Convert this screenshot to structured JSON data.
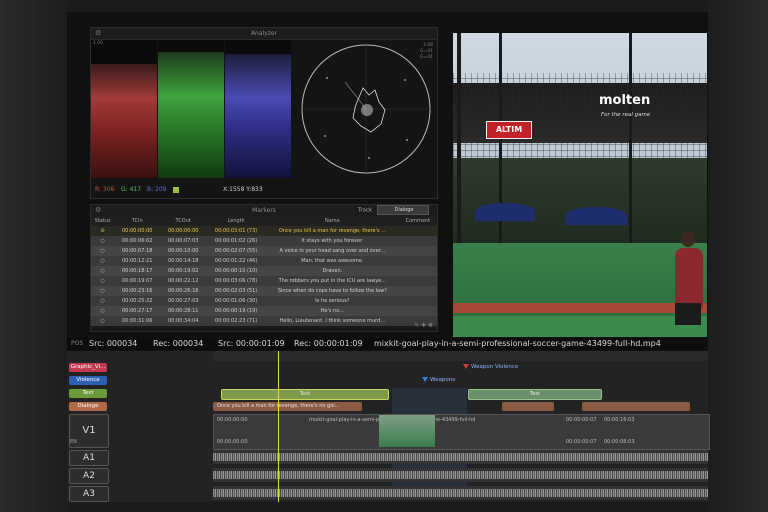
{
  "analyzer": {
    "title": "Analyzer",
    "readout_r": "R: 306",
    "readout_g": "G: 417",
    "readout_b": "B: 209",
    "readout_xy": "X:1558 Y:833",
    "scale_top": "1.00",
    "scale_lines": [
      "1:48",
      "G=41",
      "G=41"
    ]
  },
  "markers": {
    "title": "Markers",
    "track_label": "Track",
    "track_value": "Dialoge",
    "columns": [
      "Status",
      "TCIn",
      "TCOut",
      "Length",
      "Name",
      "Comment"
    ],
    "rows": [
      {
        "tcin": "00:00:00:00",
        "tcout": "00:00:00:00",
        "length": "00:00:03:01 (73)",
        "name": "Once you kill a man for revenge, there's ...",
        "selected": true
      },
      {
        "tcin": "00:00:06:02",
        "tcout": "00:00:07:03",
        "length": "00:00:01:02 (26)",
        "name": "It stays with you forever."
      },
      {
        "tcin": "00:00:07:18",
        "tcout": "00:00:10:00",
        "length": "00:00:02:07 (55)",
        "name": "A voice in your head sang over and over..."
      },
      {
        "tcin": "00:00:12:21",
        "tcout": "00:00:14:18",
        "length": "00:00:01:22 (46)",
        "name": "Man, that was awesome."
      },
      {
        "tcin": "00:00:18:17",
        "tcout": "00:00:19:02",
        "length": "00:00:00:10 (10)",
        "name": "Draven."
      },
      {
        "tcin": "00:00:19:07",
        "tcout": "00:00:22:12",
        "length": "00:00:03:06 (78)",
        "name": "The robbers you put in the ICU are lawye..."
      },
      {
        "tcin": "00:00:23:16",
        "tcout": "00:00:26:16",
        "length": "00:00:02:03 (51)",
        "name": "Since when do cops have to follow the law?"
      },
      {
        "tcin": "00:00:25:22",
        "tcout": "00:00:27:03",
        "length": "00:00:01:06 (30)",
        "name": "Is he serious?"
      },
      {
        "tcin": "00:00:27:17",
        "tcout": "00:00:28:11",
        "length": "00:00:00:19 (19)",
        "name": "He's no..."
      },
      {
        "tcin": "00:00:31:06",
        "tcout": "00:00:34:04",
        "length": "00:00:02:23 (71)",
        "name": "Hello, Lieutenant. I think someone murd..."
      }
    ]
  },
  "video": {
    "brand": "molten",
    "brand_sub": "For the real game",
    "ad": "ALTIM"
  },
  "status_bar": {
    "pos": "POS",
    "src1": "Src: 000034",
    "rec1": "Rec: 000034",
    "src2": "Src: 00:00:01:09",
    "rec2": "Rec: 00:00:01:09",
    "filename": "mixkit-goal-play-in-a-semi-professional-soccer-game-43499-full-hd.mp4"
  },
  "timeline": {
    "tracks": [
      {
        "label": "Graphic_Vi...",
        "color": "#c23a52"
      },
      {
        "label": "Violence",
        "color": "#2f5fb3"
      },
      {
        "label": "Text",
        "color": "#6a9a3a"
      },
      {
        "label": "Dialoge",
        "color": "#b06a4a"
      }
    ],
    "markers": {
      "weapon_violence": "Weapon Violence",
      "weapons": "Weapons"
    },
    "text_clips": [
      "Text",
      "Text"
    ],
    "dialog_clip": "Once you kill a man for revenge, there's no goi...",
    "video_track": "V1",
    "video_clip": {
      "name": "mixkit-goal-play-in-a-semi-professional-soccer-game-43499-full-hd",
      "tc_start_top": "00:00:00:00",
      "tc_start_bottom": "00:00:00:00",
      "tc_mid_top": "00:00:00:07",
      "tc_mid_bottom": "00:00:00:07",
      "tc_end_top": "00:00:16:03",
      "tc_end_bottom": "00:00:08:03",
      "en": "EN"
    },
    "audio_tracks": [
      "A1",
      "A2",
      "A3"
    ],
    "audio_en": "EN"
  }
}
